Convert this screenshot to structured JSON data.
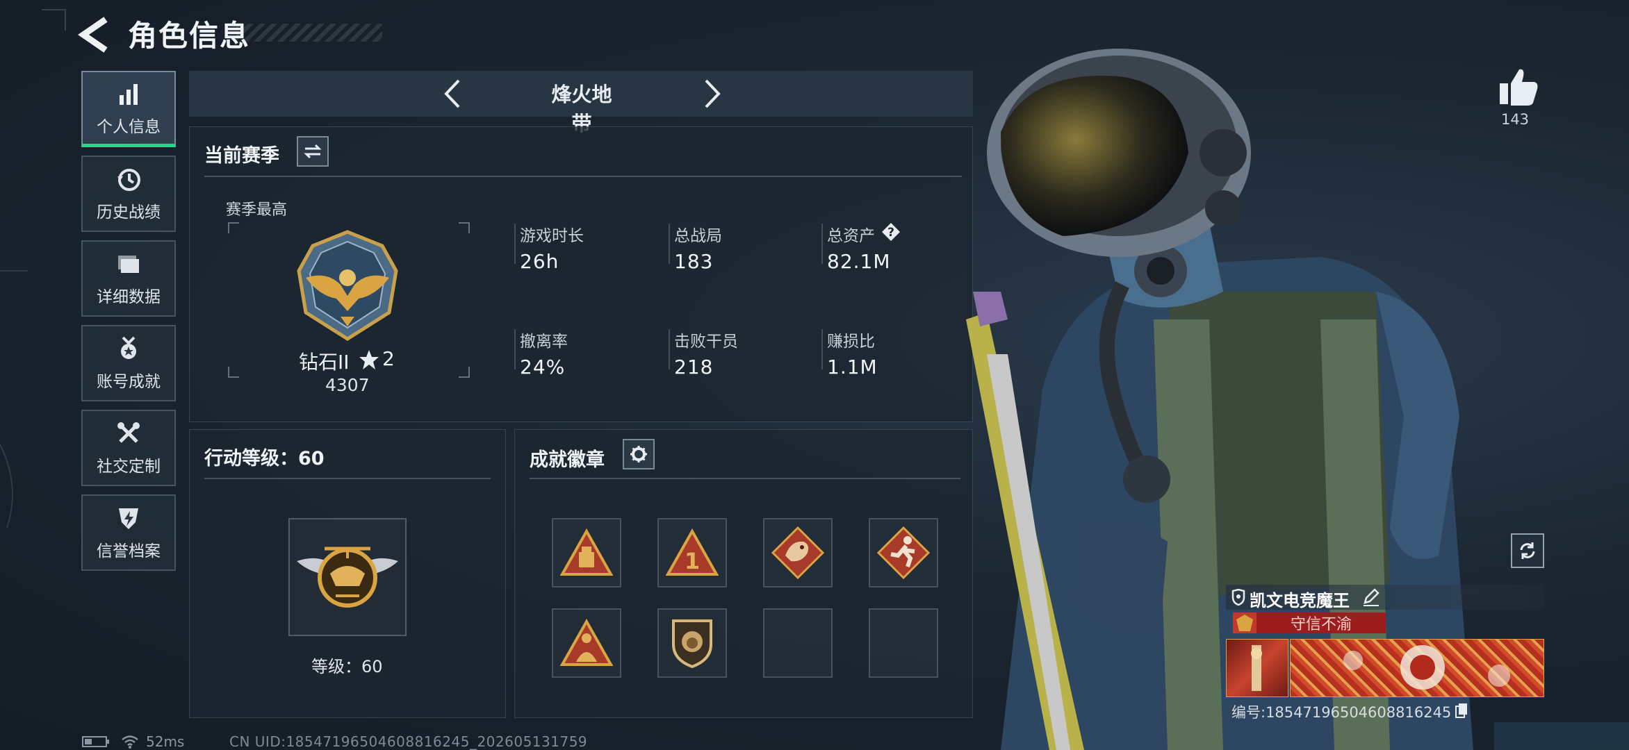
{
  "header": {
    "title": "角色信息"
  },
  "nav": {
    "items": [
      {
        "label": "个人信息",
        "icon": "bar-chart-icon",
        "active": true
      },
      {
        "label": "历史战绩",
        "icon": "clock-history-icon",
        "active": false
      },
      {
        "label": "详细数据",
        "icon": "folder-icon",
        "active": false
      },
      {
        "label": "账号成就",
        "icon": "medal-icon",
        "active": false
      },
      {
        "label": "社交定制",
        "icon": "tools-icon",
        "active": false
      },
      {
        "label": "信誉档案",
        "icon": "shield-bolt-icon",
        "active": false
      }
    ]
  },
  "mode": {
    "name": "烽火地带"
  },
  "season": {
    "title": "当前赛季",
    "best_label": "赛季最高",
    "rank_name": "钻石II",
    "rank_stars": "2",
    "rank_score": "4307",
    "stats": [
      {
        "label": "游戏时长",
        "value": "26h"
      },
      {
        "label": "总战局",
        "value": "183"
      },
      {
        "label": "总资产",
        "value": "82.1M"
      },
      {
        "label": "撤离率",
        "value": "24%"
      },
      {
        "label": "击败干员",
        "value": "218"
      },
      {
        "label": "赚损比",
        "value": "1.1M"
      }
    ]
  },
  "action_level": {
    "title": "行动等级：60",
    "level_text": "等级：60"
  },
  "badges": {
    "title": "成就徽章",
    "items": [
      "supply-badge",
      "rank-one-badge",
      "dragon-badge",
      "runner-badge",
      "soldier-badge",
      "lion-shield-badge",
      "",
      ""
    ]
  },
  "profile": {
    "likes": "143",
    "player_name": "凯文电竞魔王",
    "title_tag": "守信不渝",
    "id_text": "编号:18547196504608816245"
  },
  "footer": {
    "ping": "52ms",
    "uid": "CN UID:18547196504608816245_202605131759"
  },
  "colors": {
    "accent_green": "#27d78d",
    "title_red": "#9b1d1d",
    "badge_red": "#a83a2a",
    "gold": "#d9a441"
  }
}
